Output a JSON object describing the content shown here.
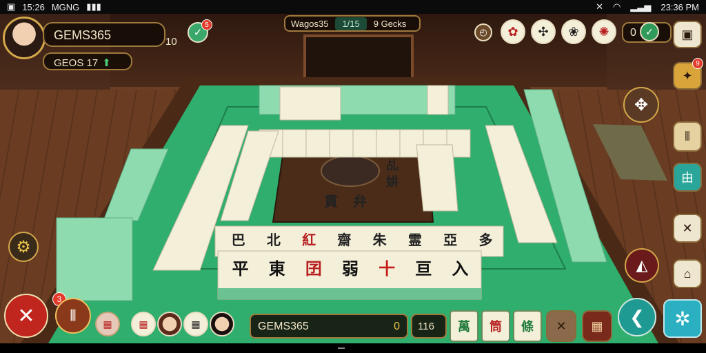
{
  "status_bar": {
    "time_left": "15:26",
    "network_left": "MGNG",
    "time_right": "23:36 PM"
  },
  "player": {
    "name": "GEMS365",
    "score": "10",
    "gems_label": "GEOS 17",
    "badge_count": "5"
  },
  "top_center": {
    "left": "Wagos35",
    "middle": "1/15",
    "right": "9 Gecks"
  },
  "top_right": {
    "counter": "0",
    "badge": "9"
  },
  "bottom": {
    "gems_label": "GEMS365",
    "gems_value": "0",
    "score": "116",
    "left_badge": "3"
  },
  "hand_tiles": [
    "萬",
    "筒",
    "條"
  ],
  "center_tiles": [
    "貫",
    "弁",
    "乩",
    "妌"
  ],
  "front_row_top": [
    "巴",
    "北",
    "紅",
    "齋",
    "朱",
    "霊",
    "亞",
    "多"
  ],
  "front_row_bottom": [
    "平",
    "東",
    "囝",
    "弱",
    "十",
    "亘",
    "入"
  ],
  "colors": {
    "felt": "#2fae6e",
    "felt_dark": "#238c58",
    "wood": "#5a3420",
    "accent_gold": "#d4a84a",
    "tile_face": "#f3efd9",
    "tile_back": "#8fdbb0"
  }
}
